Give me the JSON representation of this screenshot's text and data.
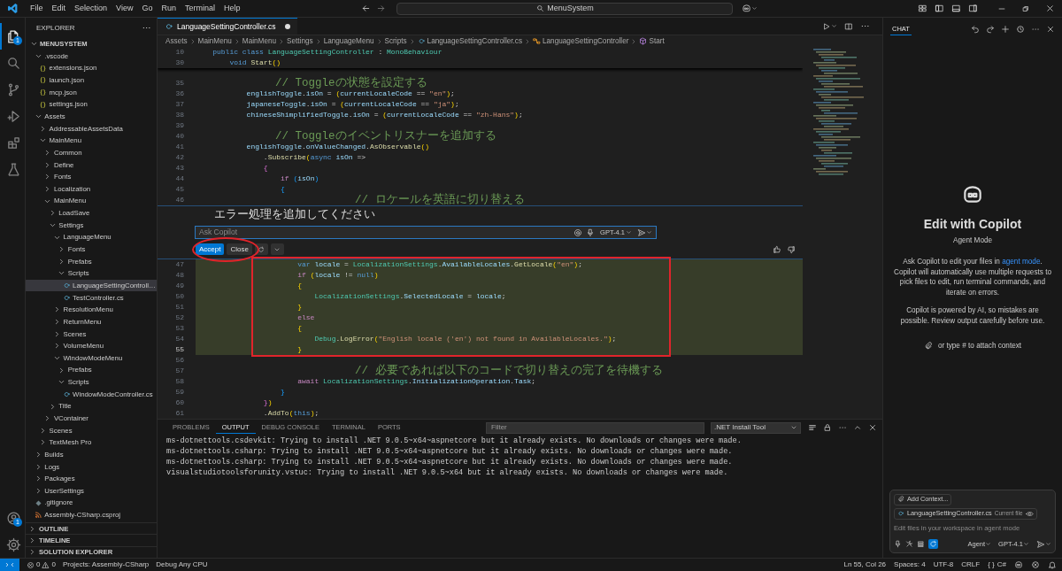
{
  "title_bar": {
    "menus": [
      "File",
      "Edit",
      "Selection",
      "View",
      "Go",
      "Run",
      "Terminal",
      "Help"
    ],
    "search": "MenuSystem"
  },
  "activity_bar": {
    "items": [
      {
        "kind": "explorer",
        "selected": true,
        "badge": "1"
      },
      {
        "kind": "search",
        "selected": false
      },
      {
        "kind": "source-control",
        "selected": false
      },
      {
        "kind": "run",
        "selected": false
      },
      {
        "kind": "extensions",
        "selected": false
      },
      {
        "kind": "testing",
        "selected": false
      }
    ],
    "bottom": [
      {
        "kind": "accounts",
        "badge": "1"
      },
      {
        "kind": "settings"
      }
    ]
  },
  "explorer": {
    "title": "EXPLORER",
    "root": {
      "label": "MENUSYSTEM",
      "kind": "root",
      "expanded": true,
      "selected": false,
      "children": [
        {
          "label": ".vscode",
          "kind": "folder",
          "expanded": true,
          "selected": false,
          "children": [
            {
              "label": "extensions.json",
              "kind": "json",
              "selected": false
            },
            {
              "label": "launch.json",
              "kind": "json",
              "selected": false
            },
            {
              "label": "mcp.json",
              "kind": "json",
              "selected": false
            },
            {
              "label": "settings.json",
              "kind": "json",
              "selected": false
            }
          ]
        },
        {
          "label": "Assets",
          "kind": "folder",
          "expanded": true,
          "selected": false,
          "children": [
            {
              "label": "AddressableAssetsData",
              "kind": "folder",
              "expanded": false,
              "selected": false
            },
            {
              "label": "MainMenu",
              "kind": "folder",
              "expanded": true,
              "selected": false,
              "children": [
                {
                  "label": "Common",
                  "kind": "folder",
                  "expanded": false,
                  "selected": false
                },
                {
                  "label": "Define",
                  "kind": "folder",
                  "expanded": false,
                  "selected": false
                },
                {
                  "label": "Fonts",
                  "kind": "folder",
                  "expanded": false,
                  "selected": false
                },
                {
                  "label": "Localization",
                  "kind": "folder",
                  "expanded": false,
                  "selected": false
                },
                {
                  "label": "MainMenu",
                  "kind": "folder",
                  "expanded": true,
                  "selected": false,
                  "children": [
                    {
                      "label": "LoadSave",
                      "kind": "folder",
                      "expanded": false,
                      "selected": false
                    },
                    {
                      "label": "Settings",
                      "kind": "folder",
                      "expanded": true,
                      "selected": false,
                      "children": [
                        {
                          "label": "LanguageMenu",
                          "kind": "folder",
                          "expanded": true,
                          "selected": false,
                          "children": [
                            {
                              "label": "Fonts",
                              "kind": "folder",
                              "expanded": false,
                              "selected": false
                            },
                            {
                              "label": "Prefabs",
                              "kind": "folder",
                              "expanded": false,
                              "selected": false
                            },
                            {
                              "label": "Scripts",
                              "kind": "folder",
                              "expanded": true,
                              "selected": false,
                              "children": [
                                {
                                  "label": "LanguageSettingControll…",
                                  "kind": "cs",
                                  "selected": true
                                },
                                {
                                  "label": "TestController.cs",
                                  "kind": "cs",
                                  "selected": false
                                }
                              ]
                            }
                          ]
                        },
                        {
                          "label": "ResolutionMenu",
                          "kind": "folder",
                          "expanded": false,
                          "selected": false
                        },
                        {
                          "label": "ReturnMenu",
                          "kind": "folder",
                          "expanded": false,
                          "selected": false
                        },
                        {
                          "label": "Scenes",
                          "kind": "folder",
                          "expanded": false,
                          "selected": false
                        },
                        {
                          "label": "VolumeMenu",
                          "kind": "folder",
                          "expanded": false,
                          "selected": false
                        },
                        {
                          "label": "WindowModeMenu",
                          "kind": "folder",
                          "expanded": true,
                          "selected": false,
                          "children": [
                            {
                              "label": "Prefabs",
                              "kind": "folder",
                              "expanded": false,
                              "selected": false
                            },
                            {
                              "label": "Scripts",
                              "kind": "folder",
                              "expanded": true,
                              "selected": false,
                              "children": [
                                {
                                  "label": "WindowModeController.cs",
                                  "kind": "cs",
                                  "selected": false
                                }
                              ]
                            }
                          ]
                        }
                      ]
                    },
                    {
                      "label": "Title",
                      "kind": "folder",
                      "expanded": false,
                      "selected": false
                    }
                  ]
                },
                {
                  "label": "VContainer",
                  "kind": "folder",
                  "expanded": false,
                  "selected": false
                }
              ]
            },
            {
              "label": "Scenes",
              "kind": "folder",
              "expanded": false,
              "selected": false
            },
            {
              "label": "TextMesh Pro",
              "kind": "folder",
              "expanded": false,
              "selected": false
            }
          ]
        },
        {
          "label": "Builds",
          "kind": "folder",
          "expanded": false,
          "selected": false
        },
        {
          "label": "Logs",
          "kind": "folder",
          "expanded": false,
          "selected": false
        },
        {
          "label": "Packages",
          "kind": "folder",
          "expanded": false,
          "selected": false
        },
        {
          "label": "UserSettings",
          "kind": "folder",
          "expanded": false,
          "selected": false
        },
        {
          "label": ".gitignore",
          "kind": "git",
          "selected": false
        },
        {
          "label": "Assembly-CSharp.csproj",
          "kind": "csproj",
          "selected": false
        }
      ]
    },
    "sections": [
      {
        "label": "OUTLINE",
        "expanded": false
      },
      {
        "label": "TIMELINE",
        "expanded": false
      },
      {
        "label": "SOLUTION EXPLORER",
        "expanded": false
      }
    ]
  },
  "editor": {
    "tabs": [
      {
        "label": "LanguageSettingController.cs",
        "modified": true,
        "selected": true
      }
    ],
    "breadcrumb": [
      {
        "kind": "folder",
        "text": "Assets"
      },
      {
        "kind": "folder",
        "text": "MainMenu"
      },
      {
        "kind": "folder",
        "text": "MainMenu"
      },
      {
        "kind": "folder",
        "text": "Settings"
      },
      {
        "kind": "folder",
        "text": "LanguageMenu"
      },
      {
        "kind": "folder",
        "text": "Scripts"
      },
      {
        "kind": "file",
        "text": "LanguageSettingController.cs"
      },
      {
        "kind": "class",
        "text": "LanguageSettingController"
      },
      {
        "kind": "method",
        "text": "Start"
      }
    ],
    "sticky_lines": [
      {
        "number": "10",
        "tokens": [
          {
            "kind": "kw",
            "text": "    public class "
          },
          {
            "kind": "type",
            "text": "LanguageSettingController"
          },
          {
            "kind": "p",
            "text": " : "
          },
          {
            "kind": "type",
            "text": "MonoBehaviour"
          }
        ]
      },
      {
        "number": "30",
        "tokens": [
          {
            "kind": "kw",
            "text": "        void "
          },
          {
            "kind": "fn",
            "text": "Start"
          },
          {
            "kind": "b1",
            "text": "()"
          }
        ]
      }
    ],
    "lines_before": [
      {
        "number": "35",
        "added": false,
        "current": false,
        "tokens": [
          {
            "kind": "cmt",
            "text": "            // Toggleの状態を設定する"
          }
        ]
      },
      {
        "number": "36",
        "added": false,
        "current": false,
        "tokens": [
          {
            "kind": "var",
            "text": "            englishToggle"
          },
          {
            "kind": "p",
            "text": "."
          },
          {
            "kind": "var",
            "text": "isOn"
          },
          {
            "kind": "p",
            "text": " = "
          },
          {
            "kind": "b1",
            "text": "("
          },
          {
            "kind": "var",
            "text": "currentLocaleCode"
          },
          {
            "kind": "p",
            "text": " == "
          },
          {
            "kind": "str",
            "text": "\"en\""
          },
          {
            "kind": "b1",
            "text": ")"
          },
          {
            "kind": "p",
            "text": ";"
          }
        ]
      },
      {
        "number": "37",
        "added": false,
        "current": false,
        "tokens": [
          {
            "kind": "var",
            "text": "            japaneseToggle"
          },
          {
            "kind": "p",
            "text": "."
          },
          {
            "kind": "var",
            "text": "isOn"
          },
          {
            "kind": "p",
            "text": " = "
          },
          {
            "kind": "b1",
            "text": "("
          },
          {
            "kind": "var",
            "text": "currentLocaleCode"
          },
          {
            "kind": "p",
            "text": " == "
          },
          {
            "kind": "str",
            "text": "\"ja\""
          },
          {
            "kind": "b1",
            "text": ")"
          },
          {
            "kind": "p",
            "text": ";"
          }
        ]
      },
      {
        "number": "38",
        "added": false,
        "current": false,
        "tokens": [
          {
            "kind": "var",
            "text": "            chineseShimplifiedToggle"
          },
          {
            "kind": "p",
            "text": "."
          },
          {
            "kind": "var",
            "text": "isOn"
          },
          {
            "kind": "p",
            "text": " = "
          },
          {
            "kind": "b1",
            "text": "("
          },
          {
            "kind": "var",
            "text": "currentLocaleCode"
          },
          {
            "kind": "p",
            "text": " == "
          },
          {
            "kind": "str",
            "text": "\"zh-Hans\""
          },
          {
            "kind": "b1",
            "text": ")"
          },
          {
            "kind": "p",
            "text": ";"
          }
        ]
      },
      {
        "number": "39",
        "added": false,
        "current": false
      },
      {
        "number": "40",
        "added": false,
        "current": false,
        "tokens": [
          {
            "kind": "cmt",
            "text": "            // Toggleのイベントリスナーを追加する"
          }
        ]
      },
      {
        "number": "41",
        "added": false,
        "current": false,
        "tokens": [
          {
            "kind": "var",
            "text": "            englishToggle"
          },
          {
            "kind": "p",
            "text": "."
          },
          {
            "kind": "var",
            "text": "onValueChanged"
          },
          {
            "kind": "p",
            "text": "."
          },
          {
            "kind": "fn",
            "text": "AsObservable"
          },
          {
            "kind": "b1",
            "text": "()"
          }
        ]
      },
      {
        "number": "42",
        "added": false,
        "current": false,
        "tokens": [
          {
            "kind": "p",
            "text": "                ."
          },
          {
            "kind": "fn",
            "text": "Subscribe"
          },
          {
            "kind": "b1",
            "text": "("
          },
          {
            "kind": "kw",
            "text": "async "
          },
          {
            "kind": "var",
            "text": "isOn"
          },
          {
            "kind": "p",
            "text": " =>"
          }
        ]
      },
      {
        "number": "43",
        "added": false,
        "current": false,
        "tokens": [
          {
            "kind": "b2",
            "text": "                {"
          }
        ]
      },
      {
        "number": "44",
        "added": false,
        "current": false,
        "tokens": [
          {
            "kind": "ctrl",
            "text": "                    if "
          },
          {
            "kind": "b3",
            "text": "("
          },
          {
            "kind": "var",
            "text": "isOn"
          },
          {
            "kind": "b3",
            "text": ")"
          }
        ]
      },
      {
        "number": "45",
        "added": false,
        "current": false,
        "tokens": [
          {
            "kind": "b3",
            "text": "                    {"
          }
        ]
      },
      {
        "number": "46",
        "added": false,
        "current": false,
        "tokens": [
          {
            "kind": "cmt",
            "text": "                        // ロケールを英語に切り替える"
          }
        ]
      }
    ],
    "lines_after": [
      {
        "number": "47",
        "added": true,
        "current": false,
        "tokens": [
          {
            "kind": "kw",
            "text": "                        var "
          },
          {
            "kind": "var",
            "text": "locale"
          },
          {
            "kind": "p",
            "text": " = "
          },
          {
            "kind": "type",
            "text": "LocalizationSettings"
          },
          {
            "kind": "p",
            "text": "."
          },
          {
            "kind": "var",
            "text": "AvailableLocales"
          },
          {
            "kind": "p",
            "text": "."
          },
          {
            "kind": "fn",
            "text": "GetLocale"
          },
          {
            "kind": "b1",
            "text": "("
          },
          {
            "kind": "str",
            "text": "\"en\""
          },
          {
            "kind": "b1",
            "text": ")"
          },
          {
            "kind": "p",
            "text": ";"
          }
        ]
      },
      {
        "number": "48",
        "added": true,
        "current": false,
        "tokens": [
          {
            "kind": "ctrl",
            "text": "                        if "
          },
          {
            "kind": "b1",
            "text": "("
          },
          {
            "kind": "var",
            "text": "locale"
          },
          {
            "kind": "p",
            "text": " != "
          },
          {
            "kind": "kw",
            "text": "null"
          },
          {
            "kind": "b1",
            "text": ")"
          }
        ]
      },
      {
        "number": "49",
        "added": true,
        "current": false,
        "tokens": [
          {
            "kind": "b1",
            "text": "                        {"
          }
        ]
      },
      {
        "number": "50",
        "added": true,
        "current": false,
        "tokens": [
          {
            "kind": "type",
            "text": "                            LocalizationSettings"
          },
          {
            "kind": "p",
            "text": "."
          },
          {
            "kind": "var",
            "text": "SelectedLocale"
          },
          {
            "kind": "p",
            "text": " = "
          },
          {
            "kind": "var",
            "text": "locale"
          },
          {
            "kind": "p",
            "text": ";"
          }
        ]
      },
      {
        "number": "51",
        "added": true,
        "current": false,
        "tokens": [
          {
            "kind": "b1",
            "text": "                        }"
          }
        ]
      },
      {
        "number": "52",
        "added": true,
        "current": false,
        "tokens": [
          {
            "kind": "ctrl",
            "text": "                        else"
          }
        ]
      },
      {
        "number": "53",
        "added": true,
        "current": false,
        "tokens": [
          {
            "kind": "b1",
            "text": "                        {"
          }
        ]
      },
      {
        "number": "54",
        "added": true,
        "current": false,
        "tokens": [
          {
            "kind": "type",
            "text": "                            Debug"
          },
          {
            "kind": "p",
            "text": "."
          },
          {
            "kind": "fn",
            "text": "LogError"
          },
          {
            "kind": "b1",
            "text": "("
          },
          {
            "kind": "str",
            "text": "\"English locale ('en') not found in AvailableLocales.\""
          },
          {
            "kind": "b1",
            "text": ")"
          },
          {
            "kind": "p",
            "text": ";"
          }
        ]
      },
      {
        "number": "55",
        "added": true,
        "current": true,
        "tokens": [
          {
            "kind": "b1",
            "text": "                        }"
          }
        ]
      },
      {
        "number": "56",
        "added": false,
        "current": false
      },
      {
        "number": "57",
        "added": false,
        "current": false,
        "tokens": [
          {
            "kind": "cmt",
            "text": "                        // 必要であれば以下のコードで切り替えの完了を待機する"
          }
        ]
      },
      {
        "number": "58",
        "added": false,
        "current": false,
        "tokens": [
          {
            "kind": "ctrl",
            "text": "                        await "
          },
          {
            "kind": "type",
            "text": "LocalizationSettings"
          },
          {
            "kind": "p",
            "text": "."
          },
          {
            "kind": "var",
            "text": "InitializationOperation"
          },
          {
            "kind": "p",
            "text": "."
          },
          {
            "kind": "var",
            "text": "Task"
          },
          {
            "kind": "p",
            "text": ";"
          }
        ]
      },
      {
        "number": "59",
        "added": false,
        "current": false,
        "tokens": [
          {
            "kind": "b3",
            "text": "                    }"
          }
        ]
      },
      {
        "number": "60",
        "added": false,
        "current": false,
        "tokens": [
          {
            "kind": "b2",
            "text": "                }"
          },
          {
            "kind": "b1",
            "text": ")"
          }
        ]
      },
      {
        "number": "61",
        "added": false,
        "current": false,
        "tokens": [
          {
            "kind": "p",
            "text": "                ."
          },
          {
            "kind": "fn",
            "text": "AddTo"
          },
          {
            "kind": "b1",
            "text": "("
          },
          {
            "kind": "kw",
            "text": "this"
          },
          {
            "kind": "b1",
            "text": ")"
          },
          {
            "kind": "p",
            "text": ";"
          }
        ]
      }
    ],
    "inline_chat": {
      "prompt": "エラー処理を追加してください",
      "placeholder": "Ask Copilot",
      "model": "GPT-4.1",
      "buttons": [
        {
          "label": "Accept",
          "primary": true
        },
        {
          "label": "Close",
          "primary": false
        }
      ]
    }
  },
  "markups": [
    {
      "kind": "ellipse",
      "color": "#e0242b"
    },
    {
      "kind": "rectangle",
      "color": "#e0242b"
    }
  ],
  "panel": {
    "tabs": [
      {
        "label": "PROBLEMS",
        "selected": false
      },
      {
        "label": "OUTPUT",
        "selected": true
      },
      {
        "label": "DEBUG CONSOLE",
        "selected": false
      },
      {
        "label": "TERMINAL",
        "selected": false
      },
      {
        "label": "PORTS",
        "selected": false
      }
    ],
    "filter_placeholder": "Filter",
    "source": ".NET Install Tool",
    "lines": [
      "ms-dotnettools.csdevkit: Trying to install .NET 9.0.5~x64~aspnetcore but it already exists. No downloads or changes were made.",
      "ms-dotnettools.csharp: Trying to install .NET 9.0.5~x64~aspnetcore but it already exists. No downloads or changes were made.",
      "ms-dotnettools.csharp: Trying to install .NET 9.0.5~x64~aspnetcore but it already exists. No downloads or changes were made.",
      "visualstudiotoolsforunity.vstuc: Trying to install .NET 9.0.5~x64 but it already exists. No downloads or changes were made."
    ]
  },
  "chat": {
    "title": "CHAT",
    "heading": "Edit with Copilot",
    "mode": "Agent Mode",
    "intro_before": "Ask Copilot to edit your files in ",
    "intro_link": "agent mode",
    "intro_after": ". Copilot will automatically use multiple requests to pick files to edit, run terminal commands, and iterate on errors.",
    "disclaimer": "Copilot is powered by AI, so mistakes are possible. Review output carefully before use.",
    "attach_hint": "or type # to attach context",
    "input": {
      "add_context": "Add Context...",
      "file": "LanguageSettingController.cs",
      "file_note": "Current file",
      "placeholder": "Edit files in your workspace in agent mode",
      "mode": "Agent",
      "model": "GPT-4.1"
    }
  },
  "status_bar": {
    "errors": "0",
    "warnings": "0",
    "project": "Projects: Assembly-CSharp",
    "config": "Debug Any CPU",
    "position": "Ln 55, Col 26",
    "indent": "Spaces: 4",
    "encoding": "UTF-8",
    "eol": "CRLF",
    "braces": "{ }",
    "language": "C#"
  }
}
